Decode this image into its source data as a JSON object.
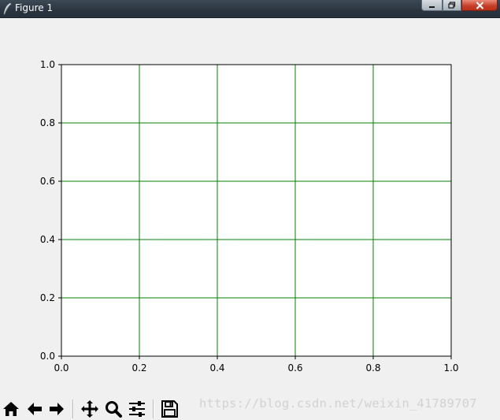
{
  "window": {
    "title": "Figure 1"
  },
  "chart_data": {
    "type": "line",
    "title": "",
    "xlabel": "",
    "ylabel": "",
    "xlim": [
      0.0,
      1.0
    ],
    "ylim": [
      0.0,
      1.0
    ],
    "x_ticks": [
      "0.0",
      "0.2",
      "0.4",
      "0.6",
      "0.8",
      "1.0"
    ],
    "y_ticks": [
      "0.0",
      "0.2",
      "0.4",
      "0.6",
      "0.8",
      "1.0"
    ],
    "grid": true,
    "grid_color": "#008000",
    "series": []
  },
  "toolbar": {
    "buttons": [
      {
        "name": "home-button",
        "icon": "home-icon"
      },
      {
        "name": "back-button",
        "icon": "arrow-left-icon"
      },
      {
        "name": "forward-button",
        "icon": "arrow-right-icon"
      },
      {
        "name": "pan-button",
        "icon": "move-icon"
      },
      {
        "name": "zoom-button",
        "icon": "magnifier-icon"
      },
      {
        "name": "configure-subplots-button",
        "icon": "sliders-icon"
      },
      {
        "name": "save-button",
        "icon": "floppy-disk-icon"
      }
    ]
  },
  "watermark": {
    "text": "https://blog.csdn.net/weixin_41789707"
  }
}
